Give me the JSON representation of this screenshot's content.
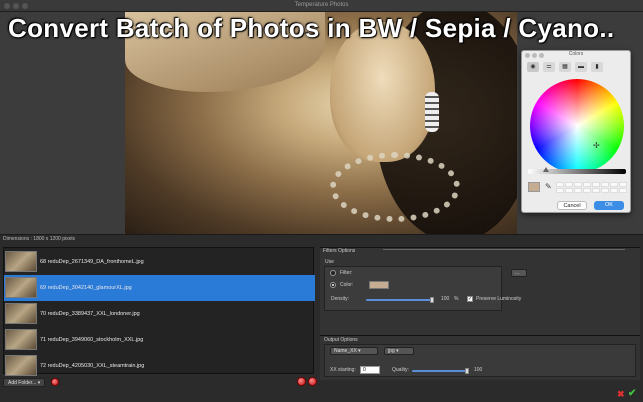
{
  "window": {
    "title": "Temperature Photos"
  },
  "headline": "Convert Batch of Photos in BW / Sepia / Cyano..",
  "dimensions_label": "Dimensions : 1800 x 1200 pixels",
  "colors_panel": {
    "title": "Colors",
    "cancel_label": "Cancel",
    "ok_label": "OK",
    "current_color": "#c4ad93"
  },
  "files": [
    {
      "name": "68 reduDep_2671349_DA_fronthomeL.jpg",
      "selected": false
    },
    {
      "name": "69 reduDep_3042140_glamourXL.jpg",
      "selected": true
    },
    {
      "name": "70 reduDep_3389437_XXL_londoner.jpg",
      "selected": false
    },
    {
      "name": "71 reduDep_3949060_stockholm_XXL.jpg",
      "selected": false
    },
    {
      "name": "72 reduDep_4205030_XXL_steamtrain.jpg",
      "selected": false
    }
  ],
  "add_folder_label": "Add Folder...",
  "filters": {
    "section_label": "Filters Options",
    "use_label": "Use",
    "filter_label": "Filter:",
    "filter_value": "...",
    "color_label": "Color:",
    "density_label": "Density:",
    "density_value": "100",
    "density_unit": "%",
    "preserve_label": "Preserve Luminosity",
    "preserve_checked": true
  },
  "output": {
    "section_label": "Output Options",
    "name_value": "Name_XX",
    "format_value": "jpg",
    "xx_starting_label": "XX starting:",
    "xx_starting_value": "0",
    "quality_label": "Quality:",
    "quality_value": "100"
  }
}
